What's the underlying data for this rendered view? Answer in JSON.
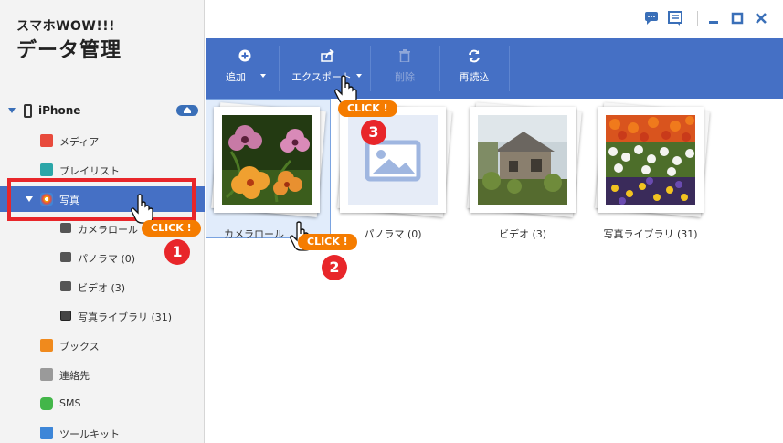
{
  "app": {
    "title_top": "スマホWOW!!!",
    "title_main": "データ管理"
  },
  "device": {
    "name": "iPhone"
  },
  "sidebar": {
    "items": [
      {
        "label": "メディア",
        "icon": "music-icon",
        "color": "#e84a3c"
      },
      {
        "label": "プレイリスト",
        "icon": "playlist-icon",
        "color": "#2ba6a8"
      },
      {
        "label": "写真",
        "icon": "photos-icon",
        "color": "#6aa2d8"
      },
      {
        "label": "カメラロール",
        "icon": "camera-icon"
      },
      {
        "label": "パノラマ (0)",
        "icon": "camera-icon"
      },
      {
        "label": "ビデオ (3)",
        "icon": "camera-icon"
      },
      {
        "label": "写真ライブラリ (31)",
        "icon": "image-icon"
      },
      {
        "label": "ブックス",
        "icon": "book-icon",
        "color": "#f08a1d"
      },
      {
        "label": "連絡先",
        "icon": "contacts-icon",
        "color": "#9a9a9a"
      },
      {
        "label": "SMS",
        "icon": "sms-icon",
        "color": "#43b649"
      },
      {
        "label": "ツールキット",
        "icon": "toolkit-icon",
        "color": "#3d86d8"
      }
    ]
  },
  "toolbar": {
    "add": "追加",
    "export": "エクスポート",
    "delete": "削除",
    "refresh": "再読込"
  },
  "albums": [
    {
      "caption": "カメラロール",
      "selected": true
    },
    {
      "caption": "パノラマ (0)"
    },
    {
      "caption": "ビデオ (3)"
    },
    {
      "caption": "写真ライブラリ (31)"
    }
  ],
  "callouts": {
    "click": "CLICK !",
    "steps": [
      "1",
      "2",
      "3"
    ]
  },
  "colors": {
    "accent": "#4570c5",
    "highlight": "#e8262a",
    "callout": "#f57c00"
  }
}
